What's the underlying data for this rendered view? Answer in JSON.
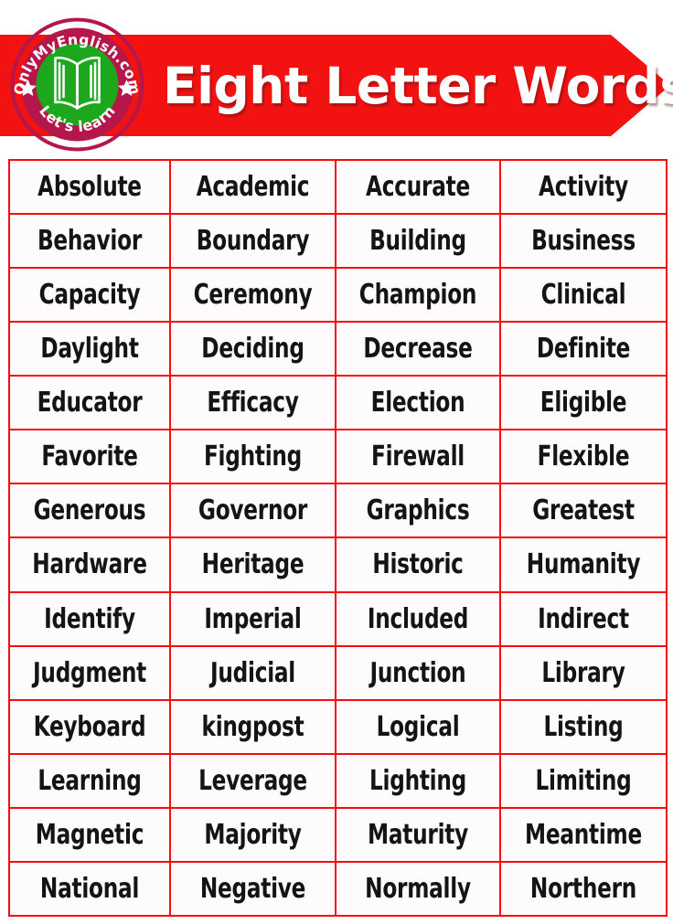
{
  "header": {
    "title": "Eight Letter Words",
    "banner_color": "#f21212",
    "title_color": "#ffffff",
    "logo": {
      "top_arc_text": "OnlyMyEnglish.com",
      "bottom_arc_text": "Let's learn",
      "ring_color": "#b5174a",
      "inner_circle_color": "#1ca71c",
      "icon": "open-book-icon",
      "left_star": "★",
      "right_star": "★"
    }
  },
  "table": {
    "border_color": "#f50d0d",
    "cell_background": "#fdfbfb",
    "text_color": "#141414",
    "columns": 4,
    "row_count": 14,
    "rows": [
      [
        "Absolute",
        "Academic",
        "Accurate",
        "Activity"
      ],
      [
        "Behavior",
        "Boundary",
        "Building",
        "Business"
      ],
      [
        "Capacity",
        "Ceremony",
        "Champion",
        "Clinical"
      ],
      [
        "Daylight",
        "Deciding",
        "Decrease",
        "Definite"
      ],
      [
        "Educator",
        "Efficacy",
        "Election",
        "Eligible"
      ],
      [
        "Favorite",
        "Fighting",
        "Firewall",
        "Flexible"
      ],
      [
        "Generous",
        "Governor",
        "Graphics",
        "Greatest"
      ],
      [
        "Hardware",
        "Heritage",
        "Historic",
        "Humanity"
      ],
      [
        "Identify",
        "Imperial",
        "Included",
        "Indirect"
      ],
      [
        "Judgment",
        "Judicial",
        "Junction",
        "Library"
      ],
      [
        "Keyboard",
        "kingpost",
        "Logical",
        "Listing"
      ],
      [
        "Learning",
        "Leverage",
        "Lighting",
        "Limiting"
      ],
      [
        "Magnetic",
        "Majority",
        "Maturity",
        "Meantime"
      ],
      [
        "National",
        "Negative",
        "Normally",
        "Northern"
      ]
    ]
  }
}
